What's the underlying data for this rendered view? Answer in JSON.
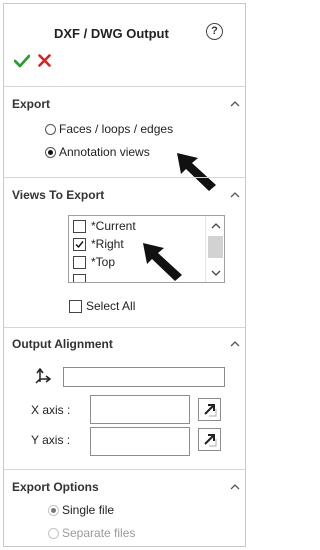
{
  "header": {
    "title": "DXF / DWG Output",
    "help_symbol": "?"
  },
  "export": {
    "title": "Export",
    "options": [
      {
        "label": "Faces / loops / edges",
        "selected": false
      },
      {
        "label": "Annotation views",
        "selected": true
      }
    ]
  },
  "views": {
    "title": "Views To Export",
    "items": [
      {
        "label": "*Current",
        "checked": false
      },
      {
        "label": "*Right",
        "checked": true
      },
      {
        "label": "*Top",
        "checked": false
      }
    ],
    "select_all": "Select All"
  },
  "alignment": {
    "title": "Output Alignment",
    "origin_value": "",
    "x_axis_label": "X axis :",
    "x_axis_value": "",
    "y_axis_label": "Y axis :",
    "y_axis_value": ""
  },
  "export_options": {
    "title": "Export Options",
    "options": [
      {
        "label": "Single file",
        "selected": true
      },
      {
        "label": "Separate files",
        "selected": false,
        "disabled": true
      }
    ]
  },
  "colors": {
    "ok": "#2e9e34",
    "cancel": "#e0201e",
    "separator": "#d6d6d6"
  }
}
